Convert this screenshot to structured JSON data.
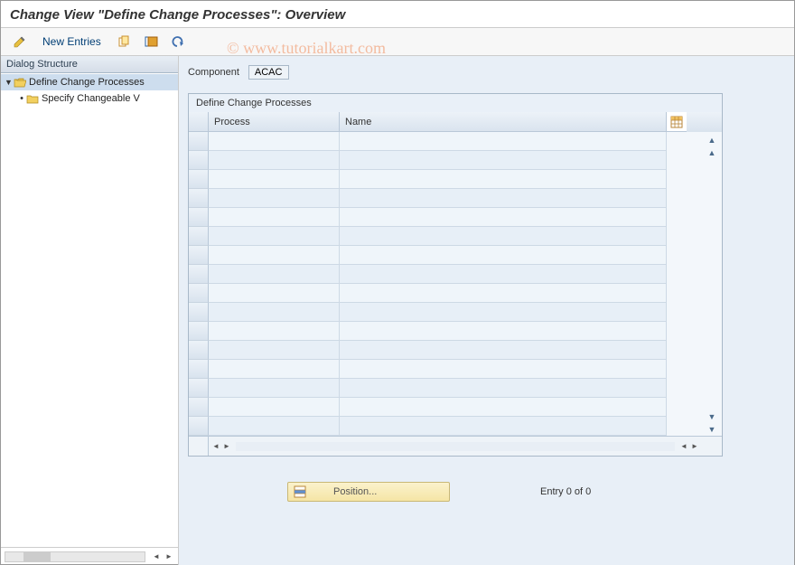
{
  "title": "Change View \"Define Change Processes\": Overview",
  "toolbar": {
    "new_entries": "New Entries"
  },
  "watermark": "© www.tutorialkart.com",
  "sidebar": {
    "header": "Dialog Structure",
    "items": [
      {
        "label": "Define Change Processes",
        "selected": true,
        "open": true
      },
      {
        "label": "Specify Changeable V",
        "selected": false,
        "open": false
      }
    ]
  },
  "component": {
    "label": "Component",
    "value": "ACAC"
  },
  "grid": {
    "title": "Define Change Processes",
    "columns": {
      "process": "Process",
      "name": "Name"
    },
    "row_count": 16
  },
  "footer": {
    "position_label": "Position...",
    "entry_text": "Entry 0 of 0"
  }
}
